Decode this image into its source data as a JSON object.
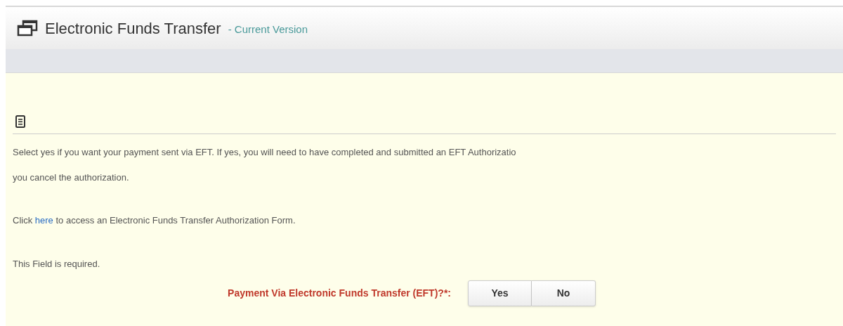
{
  "header": {
    "title": "Electronic Funds Transfer",
    "subtitle": "- Current Version"
  },
  "instructions": {
    "lines": [
      "Select yes if you want your payment sent via EFT. If yes, you will need to have completed and submitted an EFT Authorizatio",
      "you cancel the authorization."
    ]
  },
  "link_sentence": {
    "before": "Click",
    "link": "here",
    "after": "to access an Electronic Funds Transfer Authorization Form."
  },
  "required_note": "This Field is required.",
  "question": {
    "label": "Payment Via Electronic Funds Transfer (EFT)?*:",
    "options": [
      {
        "label": "Yes",
        "selected": false
      },
      {
        "label": "No",
        "selected": false
      }
    ]
  }
}
